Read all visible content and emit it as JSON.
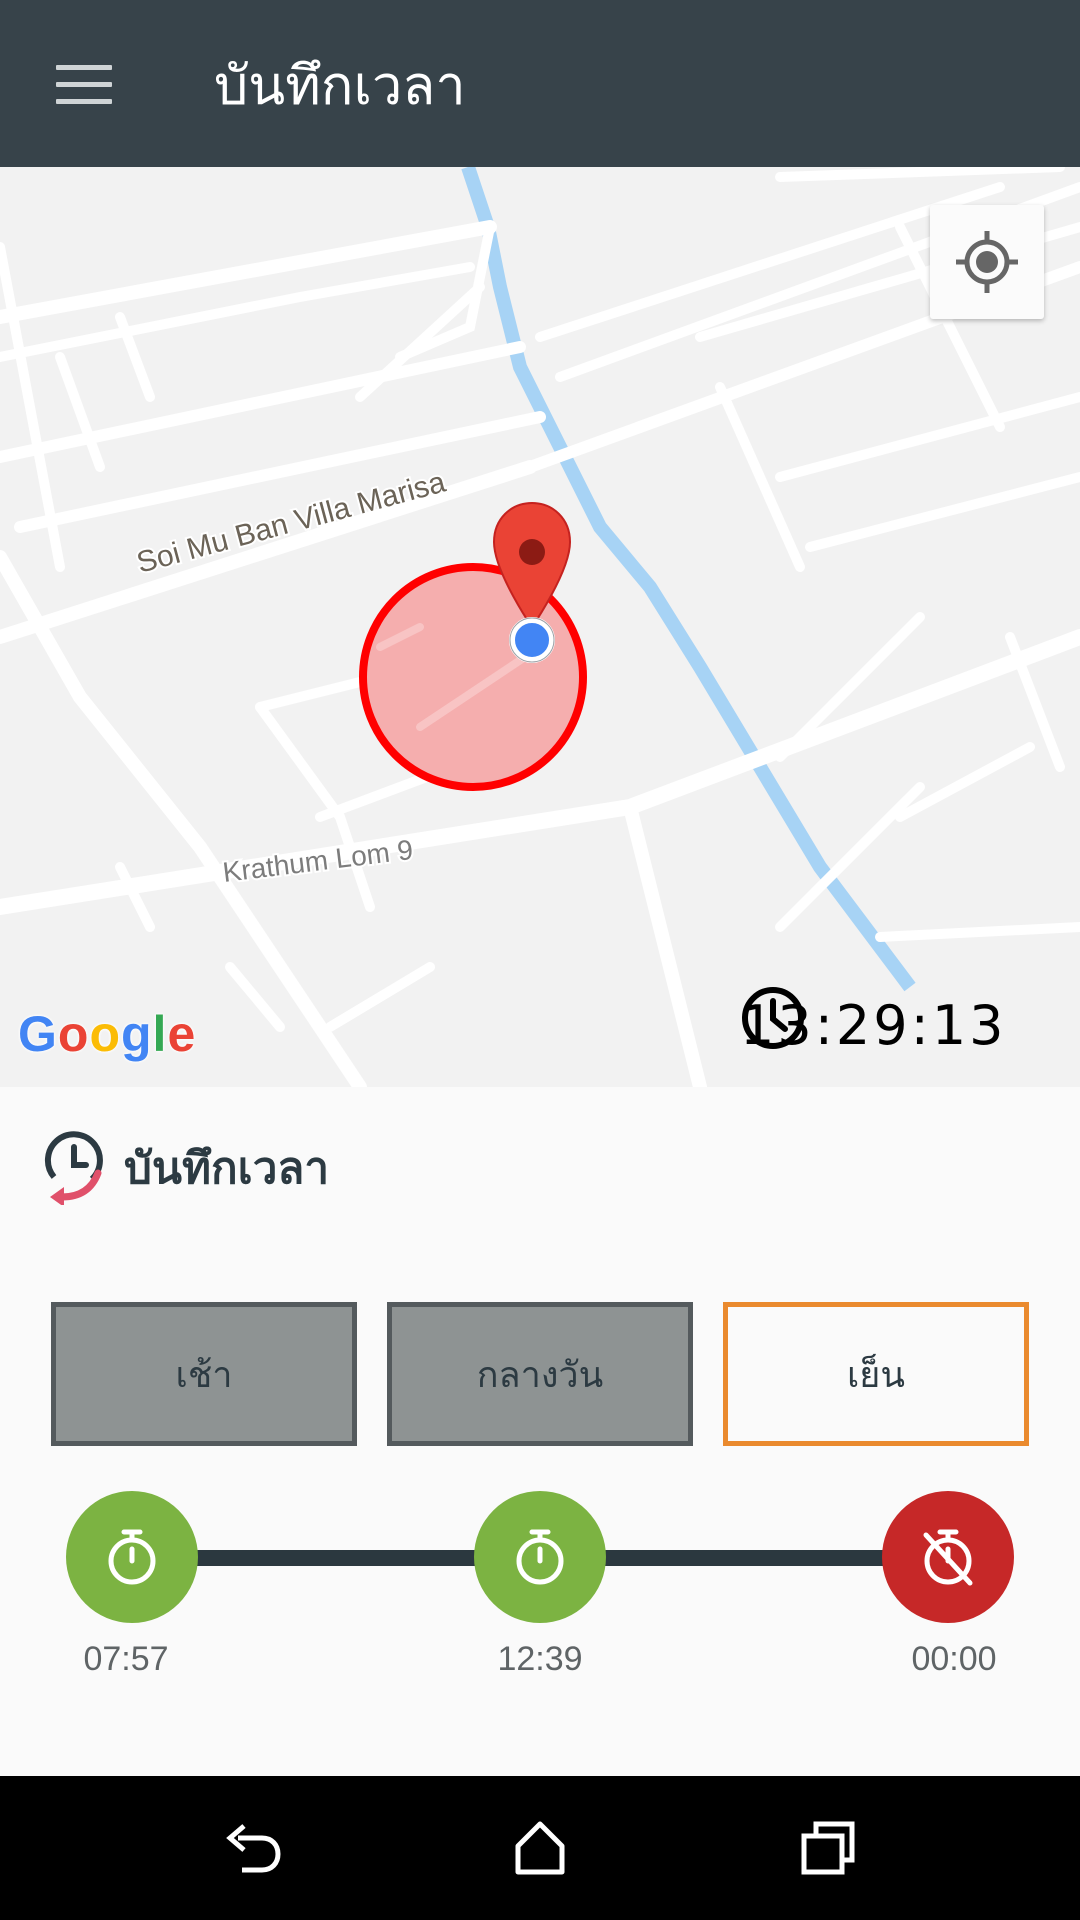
{
  "appbar": {
    "title": "บันทึกเวลา",
    "menu_icon": "hamburger-menu-icon"
  },
  "map": {
    "street_labels": [
      "Soi Mu Ban Villa Marisa",
      "Krathum Lom 9"
    ],
    "attribution": "Google",
    "locate_icon": "my-location-icon",
    "marker_icon": "map-pin-icon",
    "geofence_color": "#ff0000",
    "current_time": "13:29:13",
    "clock_icon": "clock-icon"
  },
  "panel": {
    "title": "บันทึกเวลา",
    "title_icon": "time-history-icon",
    "periods": [
      {
        "label": "เช้า",
        "active": false
      },
      {
        "label": "กลางวัน",
        "active": false
      },
      {
        "label": "เย็น",
        "active": true
      }
    ],
    "timeline": [
      {
        "time": "07:57",
        "status": "recorded",
        "icon": "stopwatch-icon",
        "color": "#7cb342"
      },
      {
        "time": "12:39",
        "status": "recorded",
        "icon": "stopwatch-icon",
        "color": "#7cb342"
      },
      {
        "time": "00:00",
        "status": "not-recorded",
        "icon": "stopwatch-off-icon",
        "color": "#c62828"
      }
    ]
  },
  "navbar": {
    "icons": [
      "back-icon",
      "home-icon",
      "recents-icon"
    ]
  },
  "colors": {
    "appbar": "#37434a",
    "accent": "#ea8a2e",
    "green": "#7cb342",
    "red": "#c62828"
  }
}
